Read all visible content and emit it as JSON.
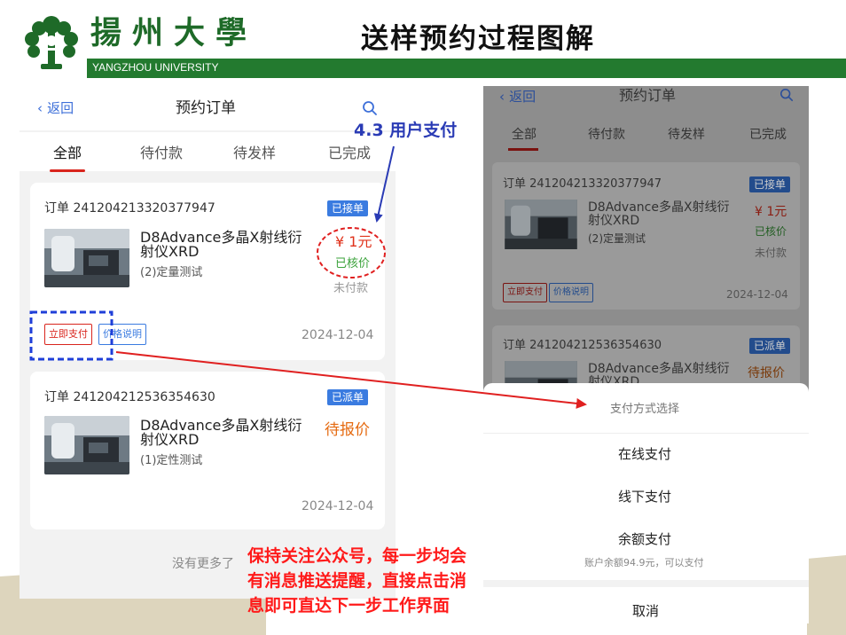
{
  "slide": {
    "university_cn": "揚州大學",
    "university_en": "YANGZHOU UNIVERSITY",
    "title": "送样预约过程图解",
    "step_label": "4.3 用户支付",
    "notice_lines": [
      "保持关注公众号，每一步均会",
      "有消息推送提醒，直接点击消",
      "息即可直达下一步工作界面"
    ]
  },
  "left_screen": {
    "back_label": "返回",
    "nav_title": "预约订单",
    "tabs": [
      "全部",
      "待付款",
      "待发样",
      "已完成"
    ],
    "orders": [
      {
        "order_id": "订单 241204213320377947",
        "badge": "已接单",
        "product_line1": "D8Advance多晶X射线衍",
        "product_line2": "射仪XRD",
        "desc": "(2)定量测试",
        "price": "¥ 1元",
        "verify": "已核价",
        "pay_state": "未付款",
        "btn_pay": "立即支付",
        "btn_price_info": "价格说明",
        "date": "2024-12-04"
      },
      {
        "order_id": "订单 241204212536354630",
        "badge": "已派单",
        "product_line1": "D8Advance多晶X射线衍",
        "product_line2": "射仪XRD",
        "desc": "(1)定性测试",
        "quote": "待报价",
        "date": "2024-12-04"
      }
    ],
    "no_more": "没有更多了"
  },
  "right_screen": {
    "back_label": "返回",
    "nav_title": "预约订单",
    "tabs": [
      "全部",
      "待付款",
      "待发样",
      "已完成"
    ],
    "order1": {
      "order_id": "订单 241204213320377947",
      "badge": "已接单",
      "product_line1": "D8Advance多晶X射线衍",
      "product_line2": "射仪XRD",
      "desc": "(2)定量测试",
      "price": "¥ 1元",
      "verify": "已核价",
      "pay_state": "未付款",
      "btn_pay": "立即支付",
      "btn_price_info": "价格说明",
      "date": "2024-12-04"
    },
    "order2": {
      "order_id": "订单 241204212536354630",
      "badge": "已派单",
      "product_line1": "D8Advance多晶X射线衍",
      "product_line2": "射仪XRD",
      "quote": "待报价"
    },
    "sheet": {
      "title": "支付方式选择",
      "online": "在线支付",
      "offline": "线下支付",
      "balance": "余额支付",
      "balance_note": "账户余额94.9元，可以支付",
      "cancel": "取消"
    }
  },
  "colors": {
    "brand_green": "#237a2f",
    "accent_blue": "#3a7be0",
    "price_red": "#e0331c",
    "annotation_red": "#ff1a1a",
    "annotation_blue": "#2a3bb5"
  },
  "icons": [
    "university-logo-icon",
    "back-chevron-icon",
    "search-icon",
    "product-photo"
  ]
}
